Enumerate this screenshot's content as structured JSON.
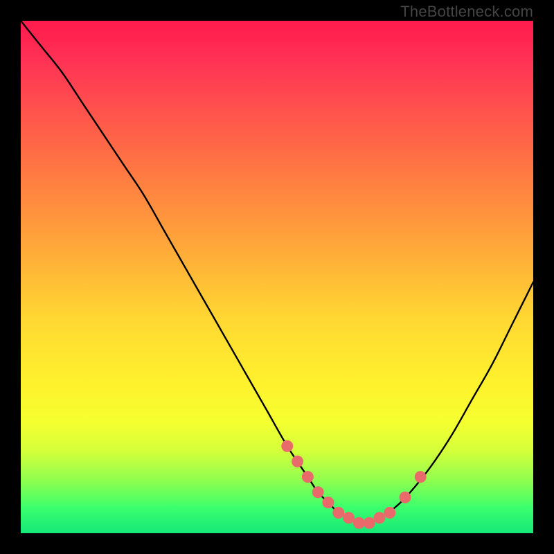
{
  "watermark": "TheBottleneck.com",
  "colors": {
    "background": "#000000",
    "gradient_top": "#ff1a4d",
    "gradient_mid": "#ffd732",
    "gradient_bottom": "#16e878",
    "curve": "#000000",
    "marker_fill": "#e86a6a",
    "marker_stroke": "#b54a4a"
  },
  "chart_data": {
    "type": "line",
    "title": "",
    "xlabel": "",
    "ylabel": "",
    "xlim": [
      0,
      100
    ],
    "ylim": [
      0,
      100
    ],
    "grid": false,
    "legend": false,
    "series": [
      {
        "name": "bottleneck-curve",
        "x": [
          0,
          4,
          8,
          12,
          16,
          20,
          24,
          28,
          32,
          36,
          40,
          44,
          48,
          52,
          56,
          58,
          60,
          62,
          64,
          66,
          68,
          70,
          73,
          76,
          80,
          84,
          88,
          92,
          96,
          100
        ],
        "values": [
          100,
          95,
          90,
          84,
          78,
          72,
          66,
          59,
          52,
          45,
          38,
          31,
          24,
          17,
          11,
          8,
          6,
          4,
          3,
          2,
          2,
          3,
          5,
          8,
          13,
          19,
          26,
          33,
          41,
          49
        ]
      }
    ],
    "markers": {
      "name": "highlight-points",
      "x": [
        52,
        54,
        56,
        58,
        60,
        62,
        64,
        66,
        68,
        70,
        72,
        75,
        78
      ],
      "values": [
        17,
        14,
        11,
        8,
        6,
        4,
        3,
        2,
        2,
        3,
        4,
        7,
        11
      ]
    }
  }
}
